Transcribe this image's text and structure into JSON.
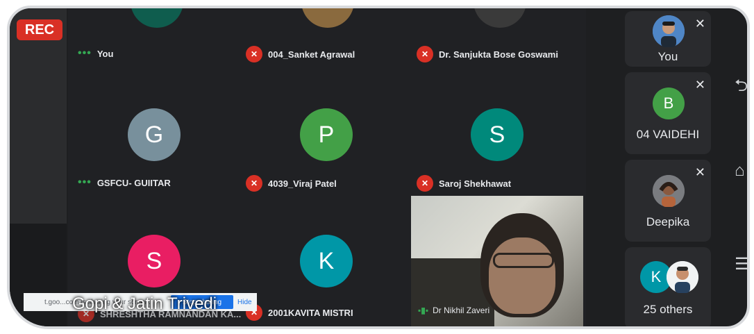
{
  "rec_label": "REC",
  "grid": {
    "tiles": [
      {
        "name": "You",
        "status": "speaking",
        "avatar": ""
      },
      {
        "name": "004_Sanket Agrawal",
        "status": "muted",
        "avatar": ""
      },
      {
        "name": "Dr. Sanjukta Bose Goswami",
        "status": "muted",
        "avatar": ""
      },
      {
        "name": "GSFCU- GUIITAR",
        "status": "speaking",
        "avatar": "G",
        "color": "#78909c"
      },
      {
        "name": "4039_Viraj Patel",
        "status": "muted",
        "avatar": "P",
        "color": "#43a047"
      },
      {
        "name": "Saroj Shekhawat",
        "status": "muted",
        "avatar": "S",
        "color": "#00897b"
      },
      {
        "name": "SHRESHTHA RAMNANDAN KA...",
        "status": "muted",
        "avatar": "S",
        "color": "#e91e63"
      },
      {
        "name": "2001KAVITA MISTRI",
        "status": "muted",
        "avatar": "K",
        "color": "#0097a7"
      }
    ]
  },
  "video_tile": {
    "name": "Dr Nikhil Zaveri"
  },
  "share_banner": {
    "text": "t.goo...com is sharing your screen.",
    "stop_label": "Stop sharing",
    "hide_label": "Hide"
  },
  "presenter_caption": "Gopi & Jatin Trivedi",
  "sidebar": [
    {
      "name": "You",
      "avatar": "",
      "muted": true
    },
    {
      "name": "04 VAIDEHI",
      "avatar": "B",
      "muted": true,
      "color": "#43a047"
    },
    {
      "name": "Deepika",
      "avatar": "",
      "muted": true
    },
    {
      "name": "25 others",
      "avatar": "K",
      "muted": false,
      "color": "#0097a7"
    }
  ],
  "nav_icons": [
    "back-icon",
    "home-icon",
    "menu-icon"
  ]
}
